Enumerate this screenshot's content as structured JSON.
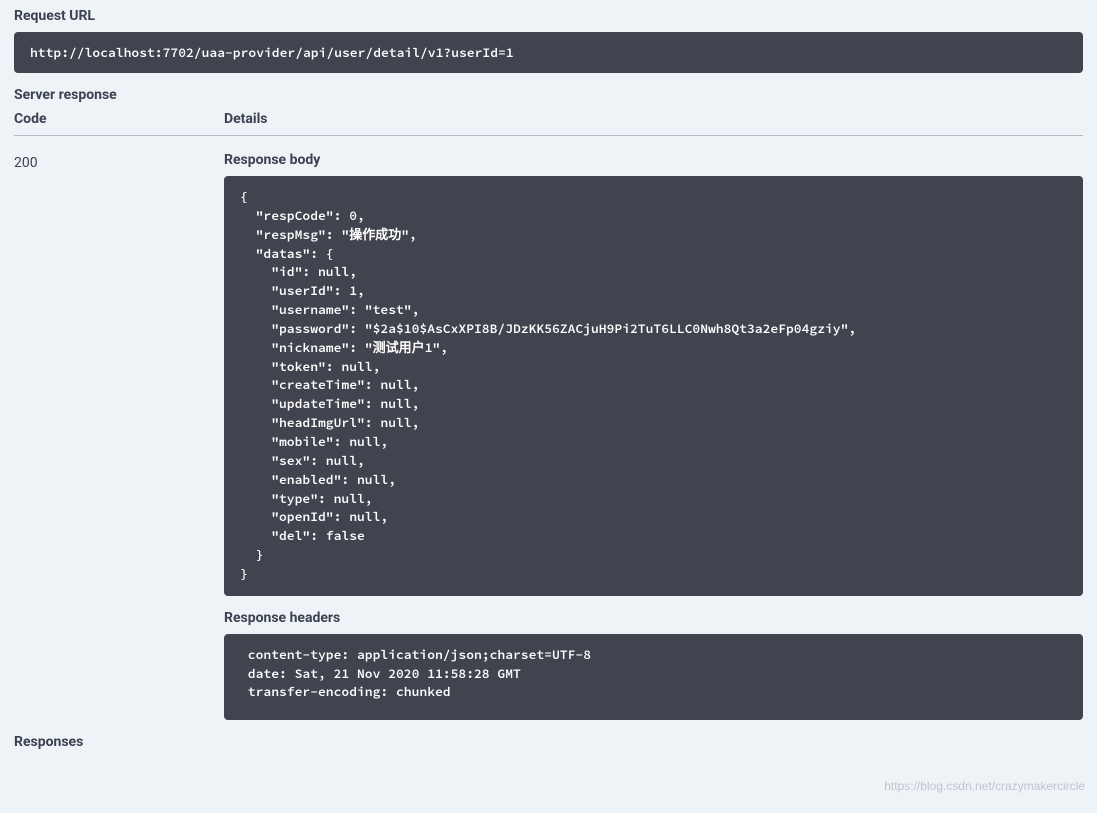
{
  "labels": {
    "request_url": "Request URL",
    "server_response": "Server response",
    "code": "Code",
    "details": "Details",
    "response_body": "Response body",
    "response_headers": "Response headers",
    "responses": "Responses"
  },
  "request_url": "http://localhost:7702/uaa-provider/api/user/detail/v1?userId=1",
  "status_code": "200",
  "response_body": "{\n  \"respCode\": 0,\n  \"respMsg\": \"操作成功\",\n  \"datas\": {\n    \"id\": null,\n    \"userId\": 1,\n    \"username\": \"test\",\n    \"password\": \"$2a$10$AsCxXPI8B/JDzKK56ZACjuH9Pi2TuT6LLC0Nwh8Qt3a2eFp04gziy\",\n    \"nickname\": \"测试用户1\",\n    \"token\": null,\n    \"createTime\": null,\n    \"updateTime\": null,\n    \"headImgUrl\": null,\n    \"mobile\": null,\n    \"sex\": null,\n    \"enabled\": null,\n    \"type\": null,\n    \"openId\": null,\n    \"del\": false\n  }\n}",
  "response_headers": " content-type: application/json;charset=UTF-8 \n date: Sat, 21 Nov 2020 11:58:28 GMT \n transfer-encoding: chunked ",
  "watermark": "https://blog.csdn.net/crazymakercircle"
}
